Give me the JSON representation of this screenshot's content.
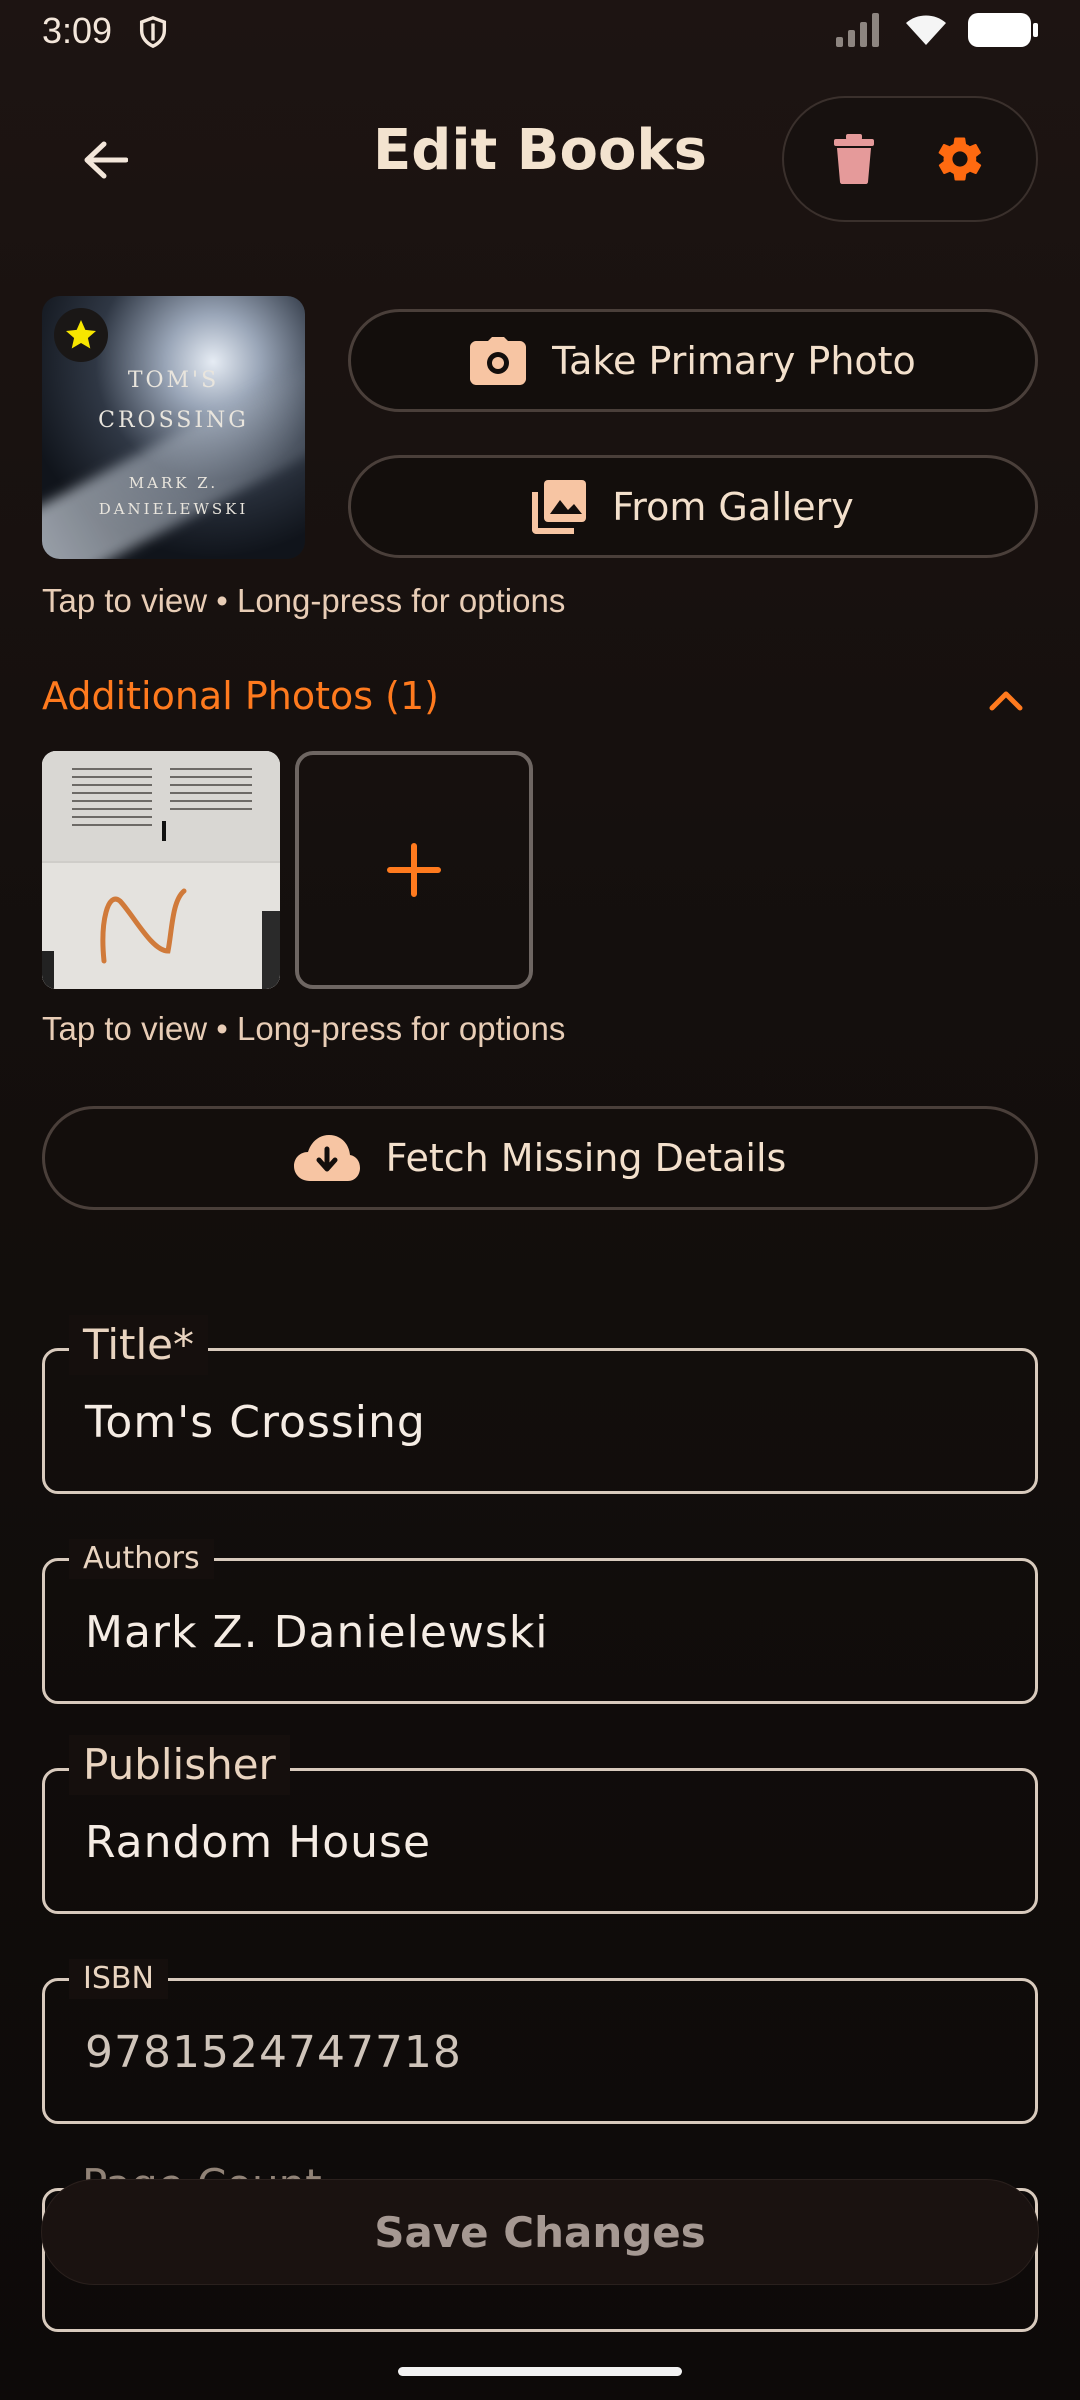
{
  "status": {
    "time": "3:09"
  },
  "header": {
    "title": "Edit Books"
  },
  "cover": {
    "line1": "TOM'S",
    "line2": "CROSSING",
    "line3": "MARK Z.",
    "line4": "DANIELEWSKI"
  },
  "primary_photo": {
    "take_label": "Take Primary Photo",
    "gallery_label": "From Gallery",
    "hint": "Tap to view • Long-press for options"
  },
  "additional": {
    "heading": "Additional Photos (1)",
    "hint": "Tap to view • Long-press for options"
  },
  "fetch": {
    "label": "Fetch Missing Details"
  },
  "fields": [
    {
      "label": "Title*",
      "value": "Tom's Crossing"
    },
    {
      "label": "Authors",
      "value": "Mark Z. Danielewski"
    },
    {
      "label": "Publisher",
      "value": "Random House"
    },
    {
      "label": "ISBN",
      "value": "9781524747718"
    },
    {
      "label": "Page Count",
      "value": ""
    }
  ],
  "save": {
    "label": "Save Changes"
  },
  "colors": {
    "accent": "#ff7a1e",
    "background": "#140f0d",
    "border": "#d8cabd",
    "delete_icon": "#e59a9a",
    "star": "#f7e600"
  }
}
